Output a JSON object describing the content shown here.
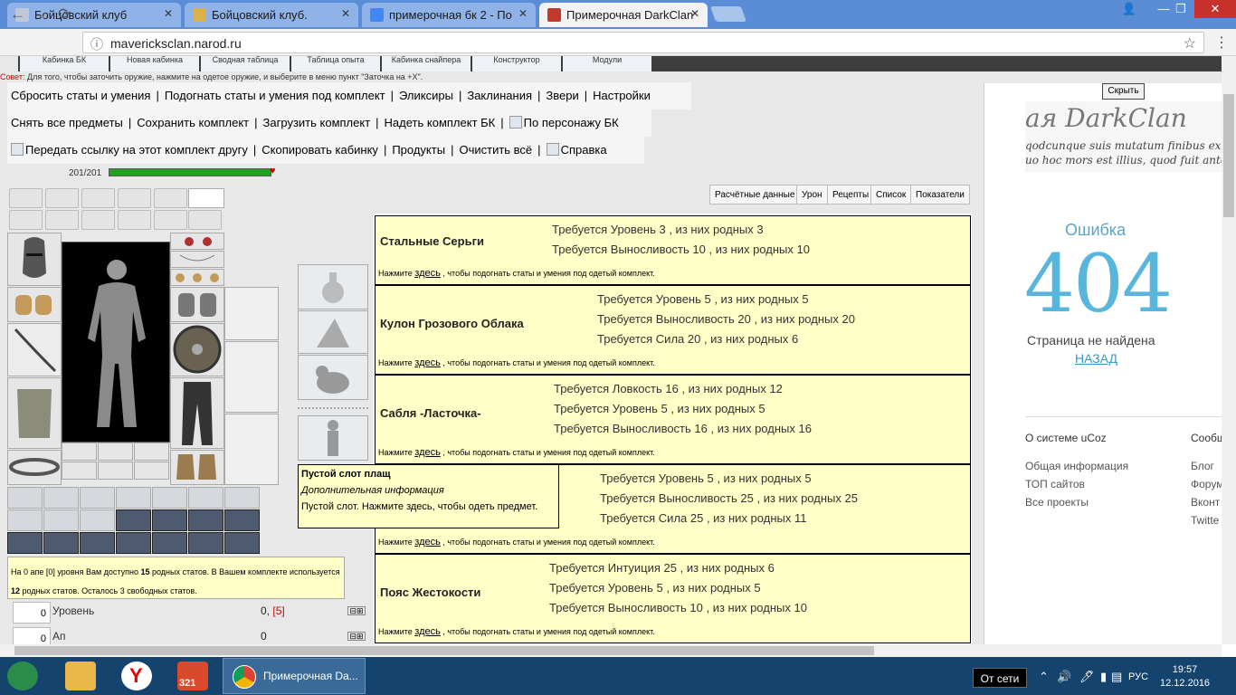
{
  "browser": {
    "tabs": [
      {
        "title": "Бойцовский клуб",
        "icon_color": "#c0c8d8"
      },
      {
        "title": "Бойцовский клуб.",
        "icon_color": "#d9b24a"
      },
      {
        "title": "примерочная бк 2 - По",
        "icon_color": "#4285f4"
      },
      {
        "title": "Примерочная DarkClan",
        "icon_color": "#c0392b"
      }
    ],
    "close_glyph": "✕",
    "url": "mavericksclan.narod.ru",
    "nav": {
      "back": "←",
      "forward": "→",
      "reload": "⟳",
      "info": "ⓘ",
      "star": "☆",
      "menu": "⋮"
    },
    "window": {
      "user": "👤",
      "minimize": "—",
      "restore": "❐",
      "close": "✕"
    }
  },
  "top_tabs": [
    "Кабинка БК",
    "Новая кабинка",
    "Сводная таблица",
    "Таблица опыта",
    "Кабинка снайпера",
    "Конструктор",
    "Модули"
  ],
  "advice": {
    "label": "Совет:",
    "text": " Для того, чтобы заточить оружие, нажмите на одетое оружие, и выберите в меню пункт \"Заточка на +X\"."
  },
  "menu_rows": [
    [
      {
        "text": "Сбросить статы и умения"
      },
      {
        "text": "Подогнать статы и умения под комплект"
      },
      {
        "text": "Эликсиры"
      },
      {
        "text": "Заклинания"
      },
      {
        "text": "Звери"
      },
      {
        "text": "Настройки"
      }
    ],
    [
      {
        "text": "Снять все предметы"
      },
      {
        "text": "Сохранить комплект"
      },
      {
        "text": "Загрузить комплект"
      },
      {
        "text": "Надеть комплект БК"
      },
      {
        "text": "По персонажу БК",
        "img": true
      }
    ],
    [
      {
        "text": "Передать ссылку на этот комплект другу",
        "img": true
      },
      {
        "text": "Скопировать кабинку"
      },
      {
        "text": "Продукты"
      },
      {
        "text": "Очистить всё"
      },
      {
        "text": "Справка",
        "img": true
      }
    ]
  ],
  "hp": {
    "text": "201/201",
    "fraction": 1.0,
    "heart": "♥"
  },
  "right_tabs": [
    "Расчётные данные",
    "Урон",
    "Рецепты",
    "Список",
    "Показатели"
  ],
  "items": [
    {
      "name": "Стальные Серьги",
      "reqs": [
        "Требуется Уровень 3 , из них родных 3",
        "Требуется Выносливость 10 , из них родных 10"
      ]
    },
    {
      "name": "Кулон Грозового Облака",
      "reqs": [
        "Требуется Уровень 5 , из них родных 5",
        "Требуется Выносливость 20 , из них родных 20",
        "Требуется Сила 20 , из них родных 6"
      ]
    },
    {
      "name": "Сабля -Ласточка-",
      "reqs": [
        "Требуется Ловкость 16 , из них родных 12",
        "Требуется Уровень 5 , из них родных 5",
        "Требуется Выносливость 16 , из них родных 16"
      ]
    },
    {
      "name": "",
      "reqs": [
        "Требуется Уровень 5 , из них родных 5",
        "Требуется Выносливость 25 , из них родных 25",
        "Требуется Сила 25 , из них родных 11"
      ]
    },
    {
      "name": "Пояс Жестокости",
      "reqs": [
        "Требуется Интуиция 25 , из них родных 6",
        "Требуется Уровень 5 , из них родных 5",
        "Требуется Выносливость 10 , из них родных 10"
      ]
    }
  ],
  "item_note": {
    "pre": "Нажмите ",
    "link": "здесь",
    "post": " , чтобы подогнать статы и умения под одетый комплект."
  },
  "tooltip": {
    "title": "Пустой слот плащ",
    "subtitle": "Дополнительная информация",
    "text": "Пустой слот. Нажмите здесь, чтобы одеть предмет."
  },
  "stats_info": {
    "p1": "На 0 апе [0] уровня Вам доступно ",
    "n1": "15",
    "p2": " родных статов. В Вашем комплекте используется ",
    "n2": "12",
    "p3": " родных статов. Осталось 3 свободных статов."
  },
  "stat_rows": [
    {
      "input": "0",
      "label": "Уровень",
      "value": "0,",
      "value_extra": "[5]",
      "pm": "⊟⊞"
    },
    {
      "input": "0",
      "label": "Ап",
      "value": "0",
      "value_extra": "",
      "pm": "⊟⊞"
    }
  ],
  "side": {
    "hide_button": "Скрыть",
    "logo_big": "ая DarkClan",
    "logo_line1": "qodcunque suis mutatum finibus exit,",
    "logo_line2": "uo hoc mors est illius, quod fuit ante",
    "error_title": "Ошибка",
    "error_code": "404",
    "error_text": "Страница не найдена",
    "error_back": "НАЗАД",
    "ucoz_head": "О системе uCoz",
    "ucoz_links": [
      "Общая информация",
      "ТОП сайтов",
      "Все проекты"
    ],
    "social_head": "Сообщ",
    "social_links": [
      "Блог",
      "Форум",
      "Вконт",
      "Twitte"
    ]
  },
  "taskbar": {
    "chrome_label": "Примерочная Da...",
    "offline": "От сети",
    "lang": "РУС",
    "time": "19:57",
    "date": "12.12.2016",
    "tray_up": "⌃",
    "tray_vol": "🔊",
    "tray_pen": "🖊",
    "tray_net": "▮",
    "tray_notes": "▤"
  },
  "colors": {
    "accent": "#5b8dd6",
    "item_bg": "#ffffc8",
    "error": "#58b6dc",
    "hp": "#22a022"
  }
}
